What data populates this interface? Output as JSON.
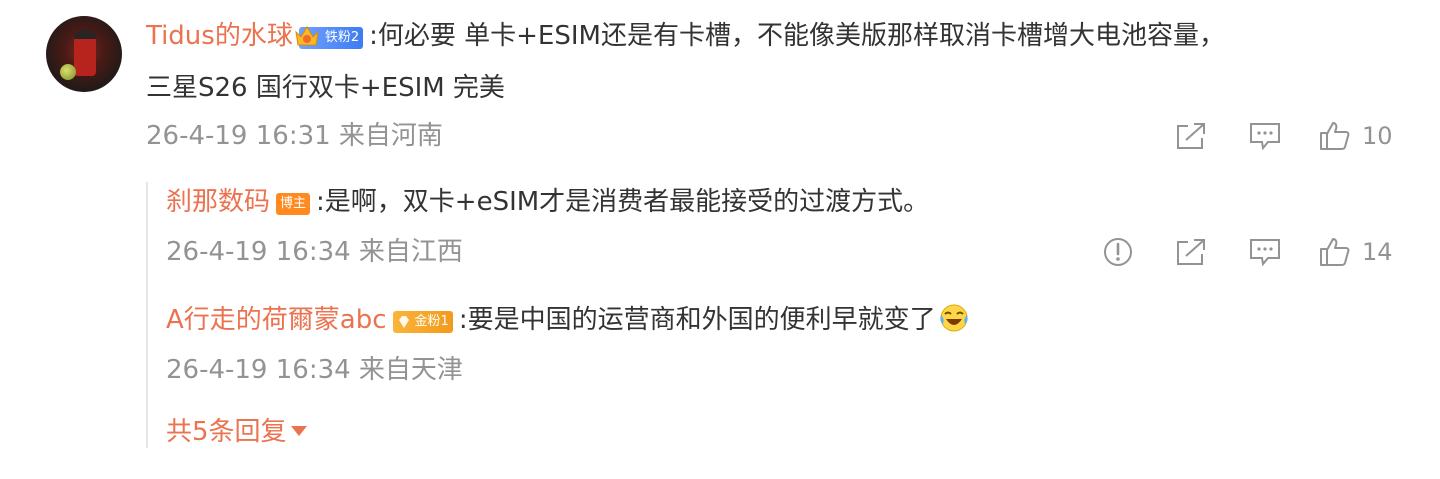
{
  "colors": {
    "accent": "#eb7350",
    "meta": "#939393",
    "text": "#333333"
  },
  "comment": {
    "author": "Tidus的水球",
    "badge": "铁粉2",
    "text_line1": ":何必要  单卡+ESIM还是有卡槽，不能像美版那样取消卡槽增大电池容量，",
    "text_line2": "三星S26 国行双卡+ESIM 完美",
    "meta": "26-4-19 16:31 来自河南",
    "like_count": "10",
    "icons": [
      "share-icon",
      "comment-icon",
      "like-icon"
    ]
  },
  "replies": [
    {
      "author": "刹那数码",
      "badge": "博主",
      "text": ":是啊，双卡+eSIM才是消费者最能接受的过渡方式。",
      "meta": "26-4-19 16:34 来自江西",
      "like_count": "14",
      "icons": [
        "report-icon",
        "share-icon",
        "comment-icon",
        "like-icon"
      ]
    },
    {
      "author": "A行走的荷爾蒙abc",
      "badge": "金粉1",
      "text": ":要是中国的运营商和外国的便利早就变了",
      "emoji": "laugh-cry-emoji",
      "meta": "26-4-19 16:34 来自天津"
    }
  ],
  "more_replies": "共5条回复"
}
